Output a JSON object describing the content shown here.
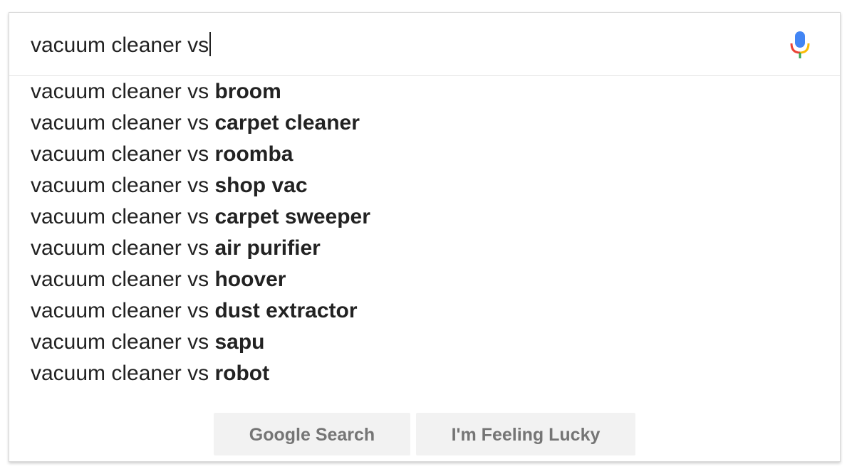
{
  "search": {
    "query": "vacuum cleaner vs",
    "mic_icon": "microphone-icon"
  },
  "suggestions": [
    {
      "prefix": "vacuum cleaner vs ",
      "completion": "broom"
    },
    {
      "prefix": "vacuum cleaner vs ",
      "completion": "carpet cleaner"
    },
    {
      "prefix": "vacuum cleaner vs ",
      "completion": "roomba"
    },
    {
      "prefix": "vacuum cleaner vs ",
      "completion": "shop vac"
    },
    {
      "prefix": "vacuum cleaner vs ",
      "completion": "carpet sweeper"
    },
    {
      "prefix": "vacuum cleaner vs ",
      "completion": "air purifier"
    },
    {
      "prefix": "vacuum cleaner vs ",
      "completion": "hoover"
    },
    {
      "prefix": "vacuum cleaner vs ",
      "completion": "dust extractor"
    },
    {
      "prefix": "vacuum cleaner vs ",
      "completion": "sapu"
    },
    {
      "prefix": "vacuum cleaner vs ",
      "completion": "robot"
    }
  ],
  "buttons": {
    "search_label": "Google Search",
    "lucky_label": "I'm Feeling Lucky"
  },
  "colors": {
    "mic_blue": "#4285F4",
    "mic_red": "#EA4335",
    "mic_yellow": "#FBBC05",
    "mic_green": "#34A853"
  }
}
